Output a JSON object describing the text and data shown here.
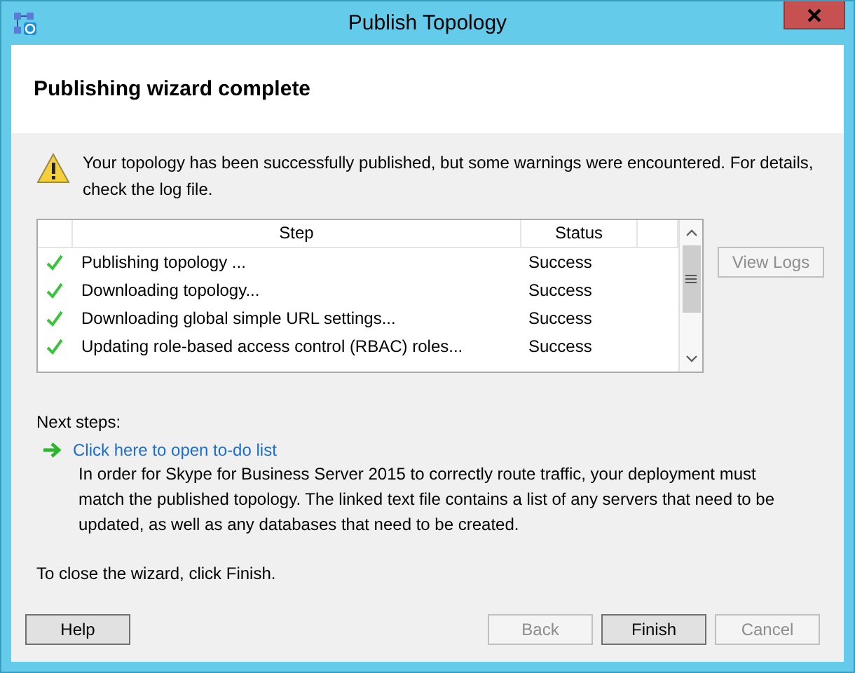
{
  "window": {
    "title": "Publish Topology"
  },
  "header": {
    "title": "Publishing wizard complete"
  },
  "message": "Your topology has been successfully published, but some warnings were encountered. For details, check the log file.",
  "table": {
    "columns": [
      "Step",
      "Status"
    ],
    "rows": [
      {
        "kind": "success",
        "step": "Publishing topology ...",
        "status": "Success"
      },
      {
        "kind": "success",
        "step": "Downloading topology...",
        "status": "Success"
      },
      {
        "kind": "success",
        "step": "Downloading global simple URL settings...",
        "status": "Success"
      },
      {
        "kind": "success",
        "step": "Updating role-based access control (RBAC) roles...",
        "status": "Success"
      }
    ]
  },
  "view_logs": {
    "label": "View Logs",
    "disabled": true
  },
  "next_steps": {
    "label": "Next steps:",
    "link": "Click here to open to-do list",
    "description": "In order for Skype for Business Server 2015 to correctly route traffic, your deployment must match the published topology. The linked text file contains a list of any servers that need to be updated, as well as any databases that need to be created."
  },
  "closing_note": "To close the wizard, click Finish.",
  "buttons": [
    {
      "label": "Help",
      "disabled": false
    },
    {
      "label": "Back",
      "disabled": true
    },
    {
      "label": "Finish",
      "disabled": false
    },
    {
      "label": "Cancel",
      "disabled": true
    }
  ]
}
